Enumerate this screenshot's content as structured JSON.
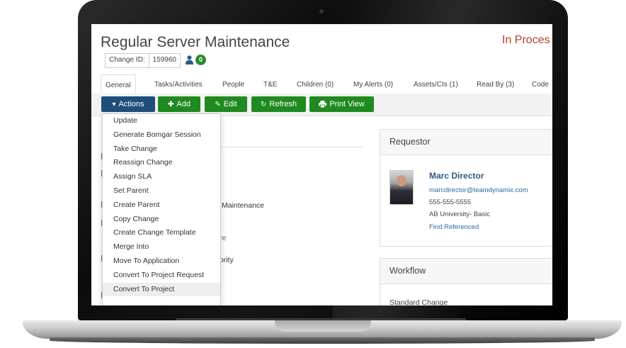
{
  "ticket": {
    "title": "Regular Server Maintenance",
    "status": "In Proces",
    "change_id_label": "Change ID:",
    "change_id_value": "159960",
    "people_count": "0"
  },
  "tabs": [
    {
      "label": "General",
      "active": true
    },
    {
      "label": "Tasks/Activities"
    },
    {
      "label": "People"
    },
    {
      "label": "T&E"
    },
    {
      "label": "Children (0)"
    },
    {
      "label": "My Alerts (0)"
    },
    {
      "label": "Assets/CIs (1)"
    },
    {
      "label": "Read By (3)"
    },
    {
      "label": "Code"
    }
  ],
  "toolbar": {
    "actions": "Actions",
    "add": "Add",
    "edit": "Edit",
    "refresh": "Refresh",
    "print_view": "Print View"
  },
  "actions_menu": [
    "Update",
    "Generate Bomgar Session",
    "Take Change",
    "Reassign Change",
    "Assign SLA",
    "Set Parent",
    "Create Parent",
    "Copy Change",
    "Create Change Template",
    "Merge Into",
    "Move To Application",
    "Convert To Project Request",
    "Convert To Project"
  ],
  "hovered_menu_item": "Convert To Project",
  "background_fragments": {
    "maintenance": "Maintenance",
    "link_fragment": "re",
    "priority_fragment": "ority"
  },
  "requestor": {
    "heading": "Requestor",
    "name": "Marc Director",
    "email": "marcdirector@teamdynamix.com",
    "phone": "555-555-5555",
    "org": "AB University- Basic",
    "find_link": "Find Referenced"
  },
  "workflow": {
    "heading": "Workflow",
    "subtext": "Standard Change"
  },
  "colors": {
    "primary_blue": "#1f4e7a",
    "action_green": "#1f8a1f",
    "status_red": "#b2402e",
    "link_blue": "#2d6aa0"
  },
  "icons": {
    "actions": "chevron-down-icon",
    "add": "plus-icon",
    "edit": "pencil-icon",
    "refresh": "refresh-icon",
    "print": "print-icon",
    "people": "person-icon"
  }
}
